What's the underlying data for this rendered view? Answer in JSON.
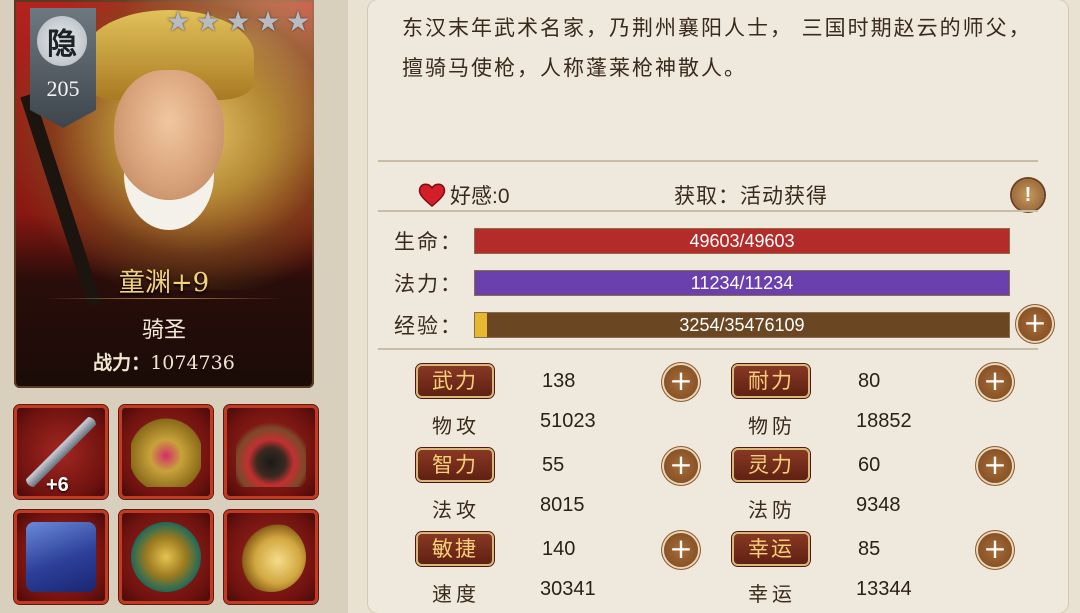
{
  "hero": {
    "rank_char": "隐",
    "rank_level": "205",
    "stars": 5,
    "star_glyph": "★",
    "name": "童渊+9",
    "title": "骑圣",
    "power_label": "战力：",
    "power_value": "1074736"
  },
  "equipment": [
    {
      "name": "spear",
      "plus": "+6"
    },
    {
      "name": "golden-armor",
      "plus": ""
    },
    {
      "name": "antler-mount",
      "plus": ""
    },
    {
      "name": "blue-book",
      "plus": ""
    },
    {
      "name": "beast-seal",
      "plus": ""
    },
    {
      "name": "bronze-mirror",
      "plus": ""
    }
  ],
  "bio": "东汉末年武术名家，乃荆州襄阳人士， 三国时期赵云的师父，擅骑马使枪，人称蓬莱枪神散人。",
  "favor": {
    "label": "好感",
    "value": ":0"
  },
  "obtain": {
    "label": "获取：活动获得"
  },
  "info_glyph": "!",
  "bars": {
    "hp": {
      "label": "生命：",
      "text": "49603/49603",
      "fill": 1.0,
      "color": "#b42c2a"
    },
    "mp": {
      "label": "法力：",
      "text": "11234/11234",
      "fill": 1.0,
      "color": "#6a3fae"
    },
    "exp": {
      "label": "经验：",
      "text": "3254/35476109",
      "fill": 0.0001,
      "color": "#6b4622",
      "knob": "#e6b830"
    }
  },
  "plus_glyph": "+",
  "attributes": [
    {
      "tag": "武力",
      "value": "138",
      "sub_label": "物攻",
      "sub_value": "51023"
    },
    {
      "tag": "耐力",
      "value": "80",
      "sub_label": "物防",
      "sub_value": "18852"
    },
    {
      "tag": "智力",
      "value": "55",
      "sub_label": "法攻",
      "sub_value": "8015"
    },
    {
      "tag": "灵力",
      "value": "60",
      "sub_label": "法防",
      "sub_value": "9348"
    },
    {
      "tag": "敏捷",
      "value": "140",
      "sub_label": "速度",
      "sub_value": "30341"
    },
    {
      "tag": "幸运",
      "value": "85",
      "sub_label": "幸运",
      "sub_value": "13344"
    }
  ]
}
